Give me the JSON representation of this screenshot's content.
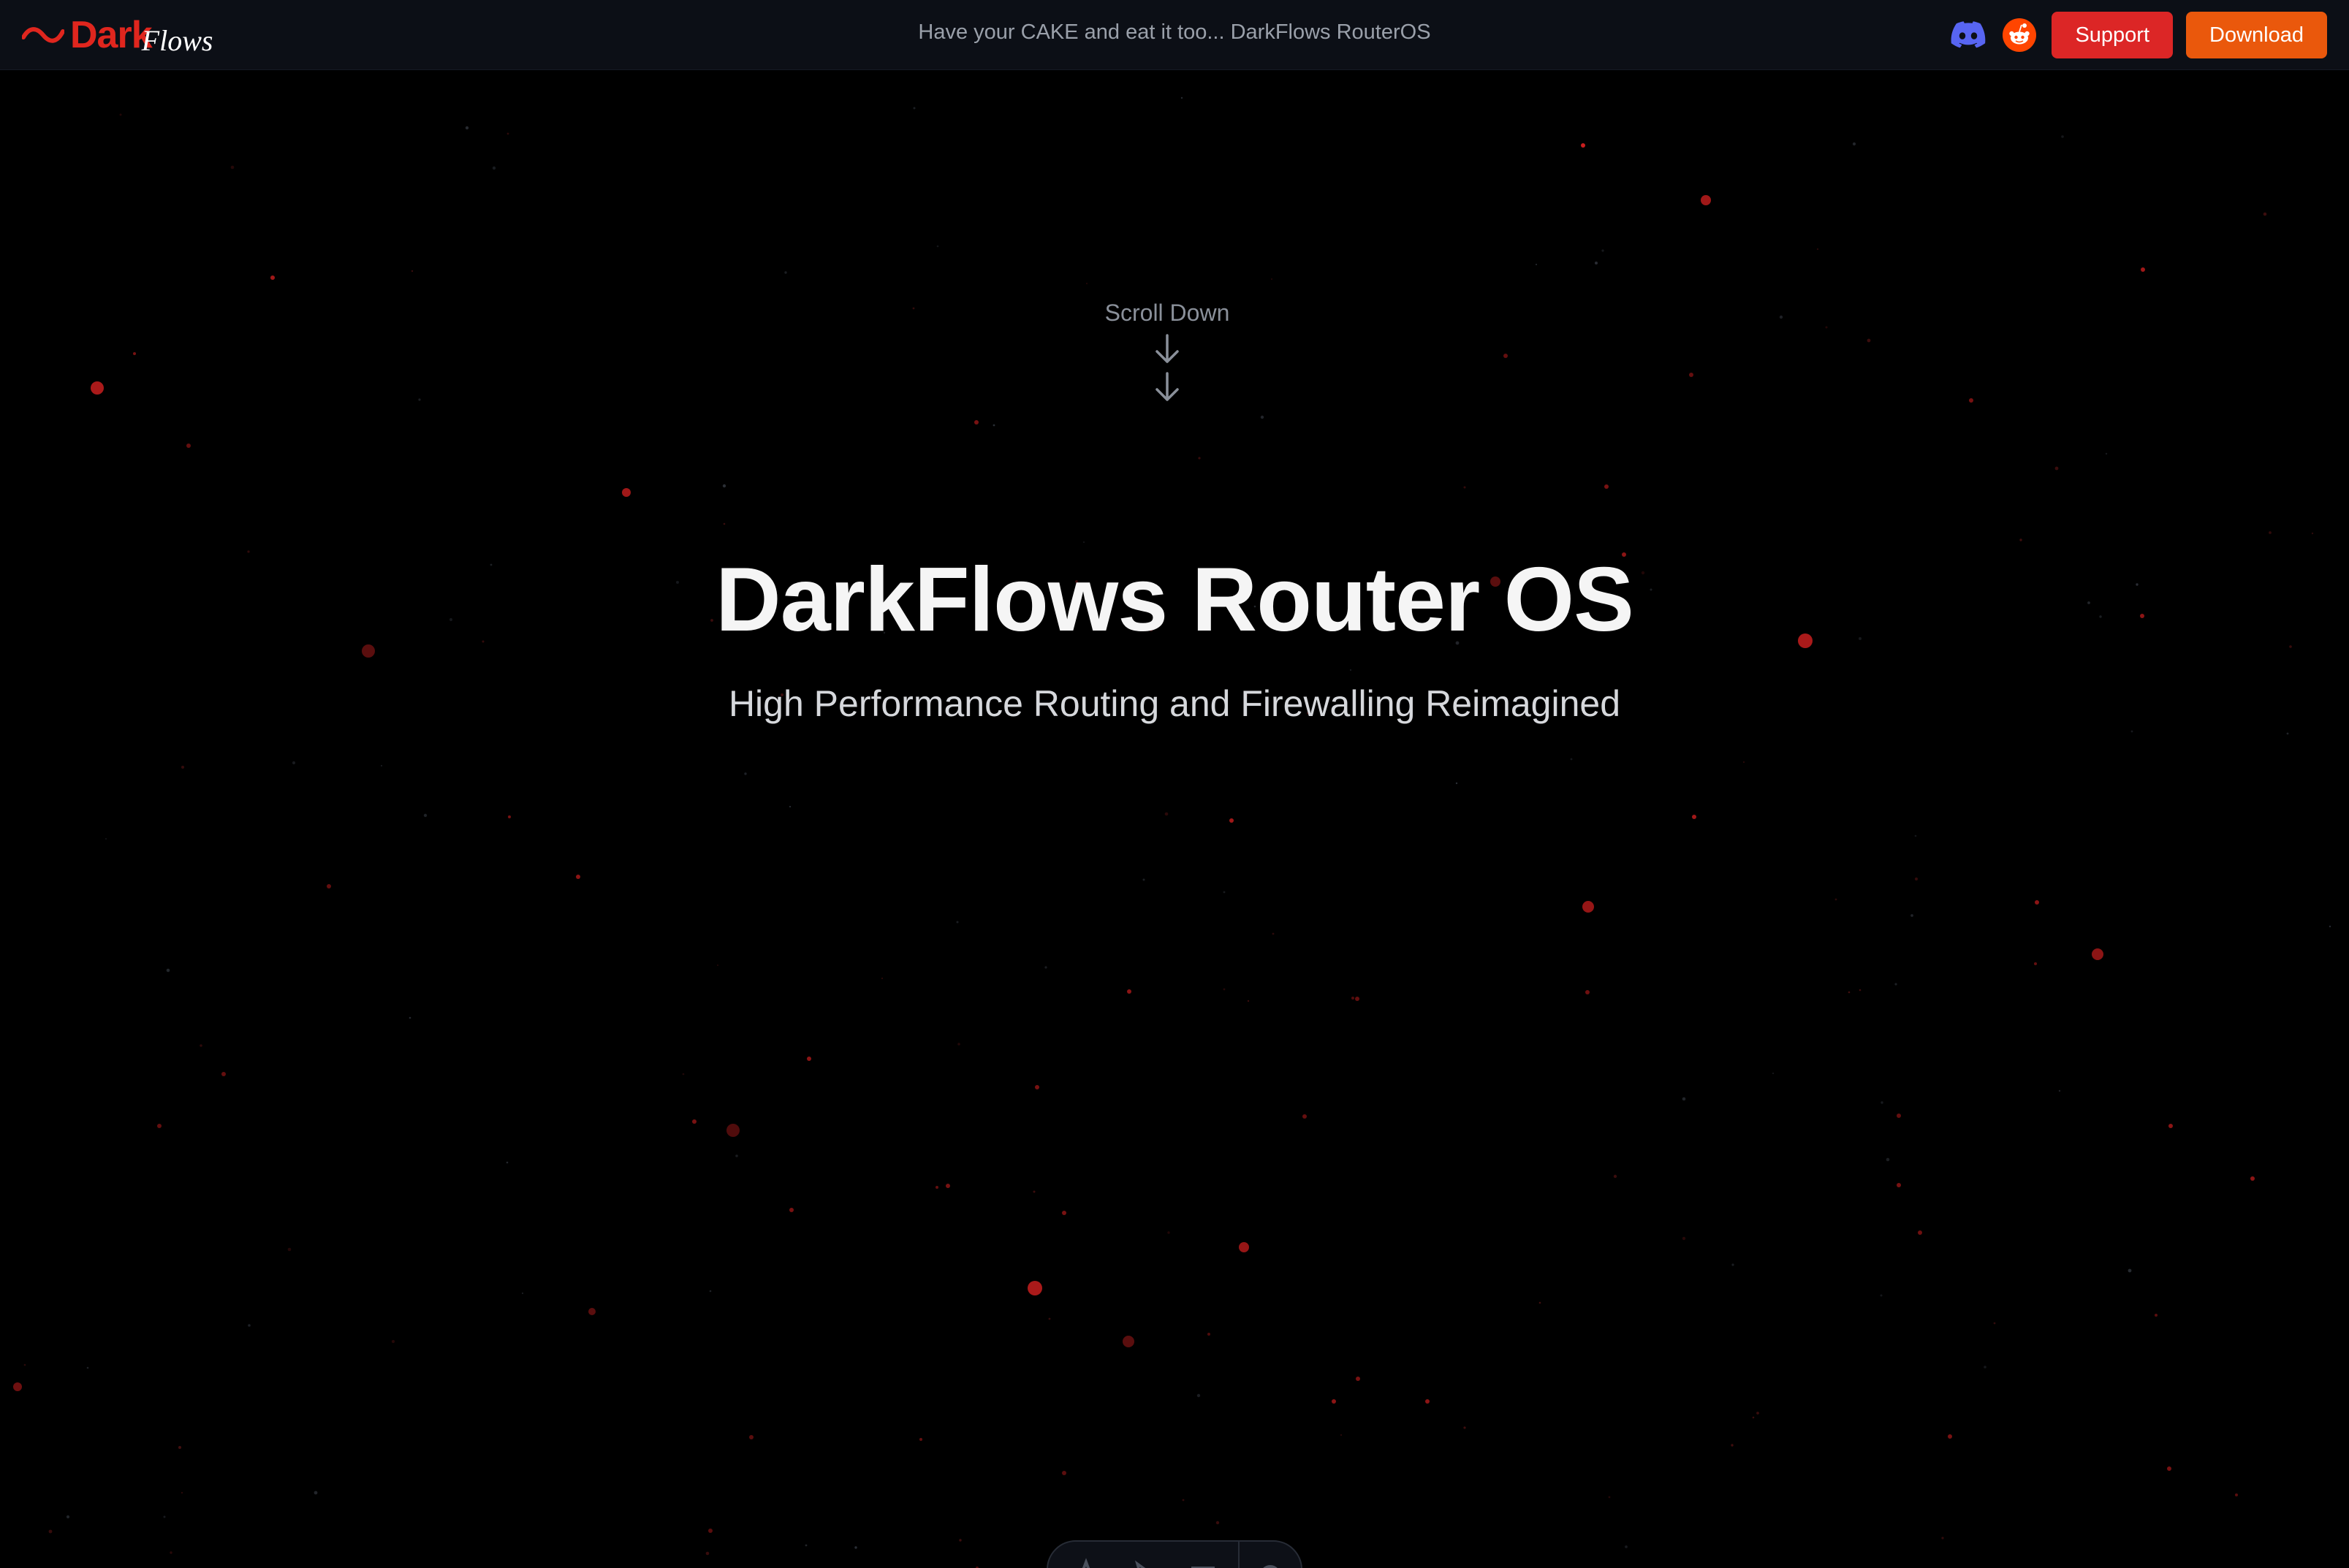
{
  "navbar": {
    "logo": {
      "dark_text": "Dark",
      "flows_text": "Flows",
      "icon": "wave-logo-icon"
    },
    "tagline": "Have your CAKE and eat it too... DarkFlows RouterOS",
    "icons": {
      "discord": "discord-icon",
      "reddit": "reddit-icon"
    },
    "support_label": "Support",
    "download_label": "Download"
  },
  "hero": {
    "scroll_label": "Scroll Down",
    "scroll_icons": [
      "arrow-down-icon",
      "arrow-down-icon"
    ],
    "title": "DarkFlows Router OS",
    "subtitle": "High Performance Routing and Firewalling Reimagined"
  },
  "dock": {
    "icons": [
      "a-icon",
      "cursor-icon",
      "menu-icon",
      "settings-icon"
    ]
  },
  "colors": {
    "background": "#000000",
    "navbar_bg": "#0c0f16",
    "brand_red": "#e0261e",
    "support_button": "#dc2626",
    "download_button": "#ea580c",
    "particle": "#c81e1e",
    "discord": "#5865f2",
    "reddit": "#ff4500"
  }
}
